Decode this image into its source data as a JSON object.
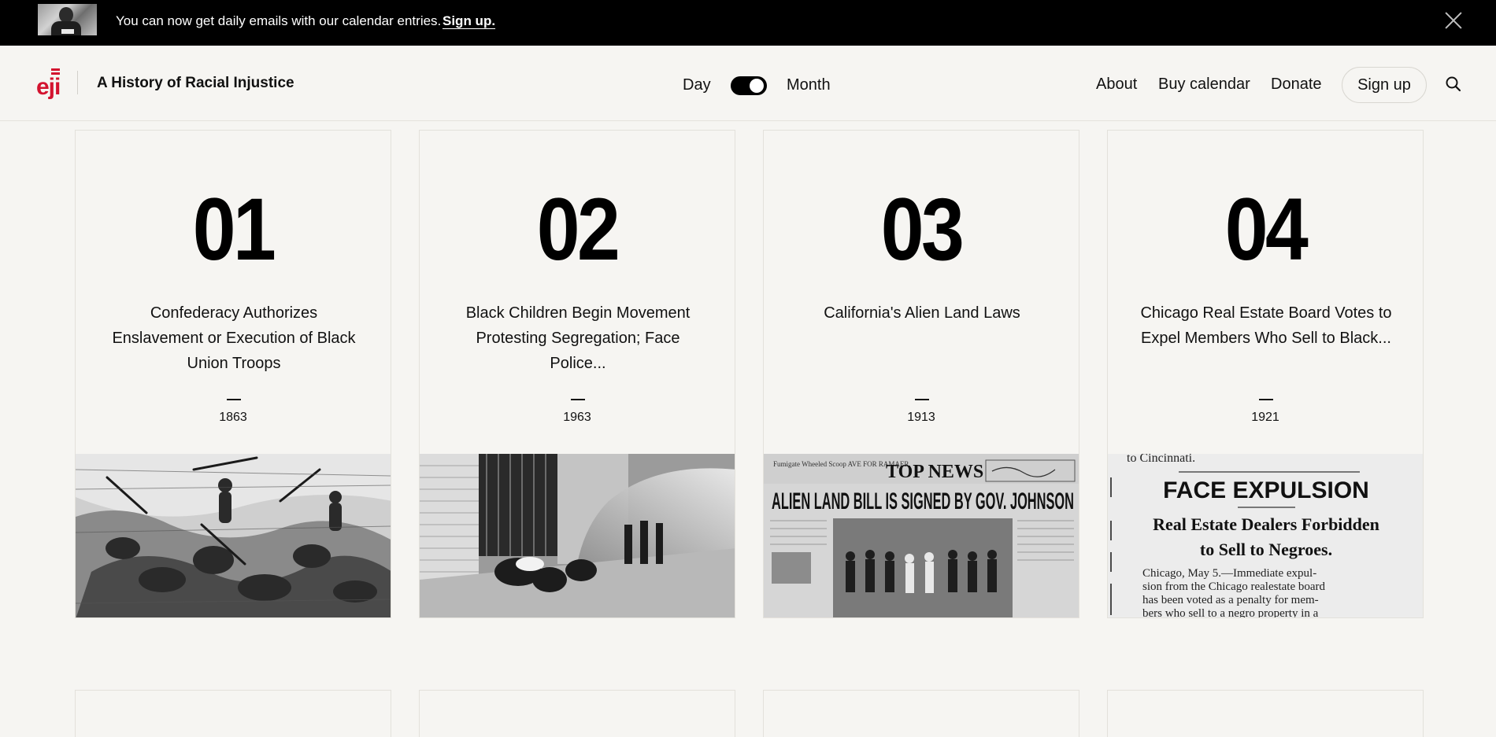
{
  "announcement": {
    "text": "You can now get daily emails with our calendar entries.",
    "link_label": "Sign up."
  },
  "header": {
    "logo_text": "eji",
    "site_title": "A History of Racial Injustice",
    "view_toggle": {
      "left_label": "Day",
      "right_label": "Month",
      "selected": "Month"
    },
    "nav": {
      "about": "About",
      "buy": "Buy calendar",
      "donate": "Donate",
      "signup": "Sign up"
    }
  },
  "entries": [
    {
      "day": "01",
      "title": "Confederacy Authorizes Enslavement or Execution of Black Union Troops",
      "year": "1863",
      "image": "battle-engraving"
    },
    {
      "day": "02",
      "title": "Black Children Begin Movement Protesting Segregation; Face Police...",
      "year": "1963",
      "image": "fire-hose-protest-photo"
    },
    {
      "day": "03",
      "title": "California's Alien Land Laws",
      "year": "1913",
      "image": "newspaper-top-news"
    },
    {
      "day": "04",
      "title": "Chicago Real Estate Board Votes to Expel Members Who Sell to Black...",
      "year": "1921",
      "image": "newspaper-clipping"
    }
  ],
  "images": {
    "newspaper_top_news": {
      "masthead": "TOP NEWS",
      "headline": "ALIEN LAND BILL IS SIGNED BY GOV. JOHNSON",
      "corner_left": "Fumigate Wheeled Scoop AVE FOR RAMAER."
    },
    "newspaper_clipping": {
      "top_line": "to Cincinnati.",
      "headline": "FACE EXPULSION",
      "subhead_line1": "Real Estate Dealers Forbidden",
      "subhead_line2": "to Sell to Negroes.",
      "body_line1": "Chicago, May 5.—Immediate expul-",
      "body_line2": "sion from the Chicago realestate board",
      "body_line3": "has been voted as a penalty for mem-",
      "body_line4": "bers who sell to a negro property in a"
    }
  },
  "colors": {
    "brand_red": "#d3132f",
    "background": "#f6f5f2",
    "bar": "#000000"
  }
}
